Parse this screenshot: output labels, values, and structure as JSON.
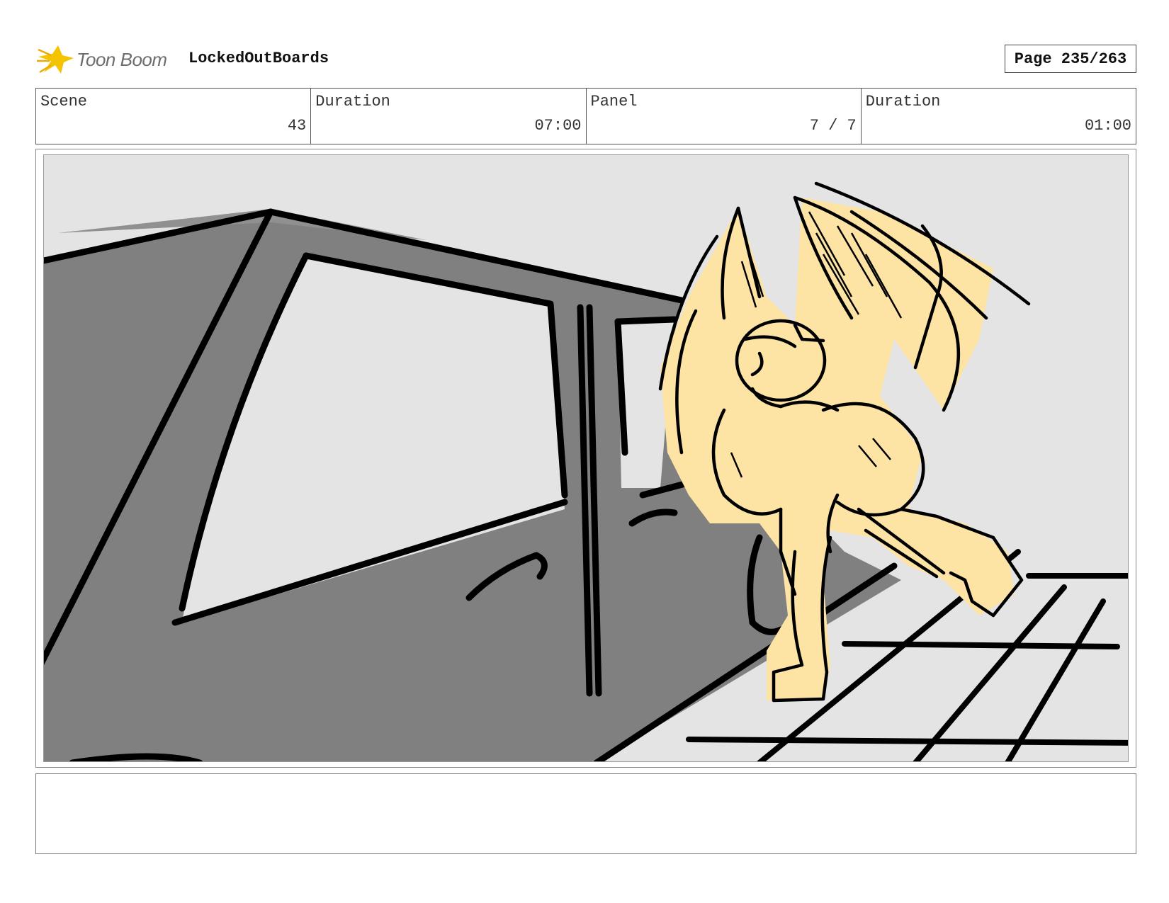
{
  "header": {
    "brand": "Toon Boom",
    "project_name": "LockedOutBoards",
    "page": "Page 235/263"
  },
  "info": {
    "scene_label": "Scene",
    "scene_value": "43",
    "scene_duration_label": "Duration",
    "scene_duration_value": "07:00",
    "panel_label": "Panel",
    "panel_value": "7 / 7",
    "panel_duration_label": "Duration",
    "panel_duration_value": "01:00"
  },
  "colors": {
    "background": "#e4e4e4",
    "car_body": "#808080",
    "window": "#e4e4e4",
    "character": "#fde3a4",
    "ink": "#000000",
    "logo_accent": "#f5c400"
  },
  "icons": {
    "logo": "toon-boom-star-icon"
  }
}
